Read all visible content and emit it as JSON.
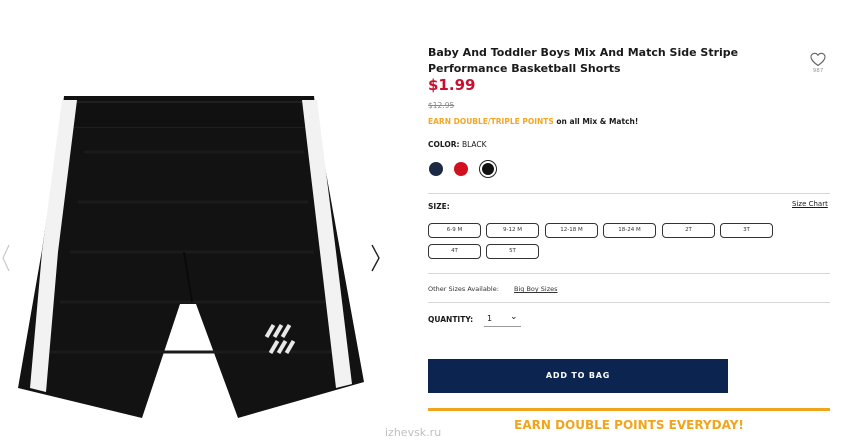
{
  "product": {
    "title": "Baby And Toddler Boys Mix And Match Side Stripe Performance Basketball Shorts",
    "price": "$1.99",
    "original_price": "$12.95",
    "promo_highlight": "EARN DOUBLE/TRIPLE POINTS",
    "promo_rest": " on all Mix & Match!"
  },
  "wishlist": {
    "icon": "heart-icon",
    "count": "987"
  },
  "color": {
    "label": "COLOR:",
    "selected": "BLACK",
    "swatches": [
      {
        "name": "navy",
        "hex": "#1d2a44"
      },
      {
        "name": "red",
        "hex": "#d0101e"
      },
      {
        "name": "black",
        "hex": "#111111",
        "selected": true
      }
    ]
  },
  "size": {
    "label": "SIZE:",
    "chart_link": "Size Chart",
    "options": [
      "6-9 M",
      "9-12 M",
      "12-18 M",
      "18-24 M",
      "2T",
      "3T",
      "4T",
      "5T"
    ]
  },
  "other_sizes": {
    "label": "Other Sizes Available:",
    "link": "Big Boy Sizes"
  },
  "quantity": {
    "label": "QUANTITY:",
    "value": "1"
  },
  "add_to_bag": "ADD TO BAG",
  "banner": "EARN DOUBLE POINTS EVERYDAY!",
  "watermark": "izhevsk.ru",
  "colors": {
    "price_red": "#c8102e",
    "accent_orange": "#f0a51c",
    "button_navy": "#0b2550"
  }
}
